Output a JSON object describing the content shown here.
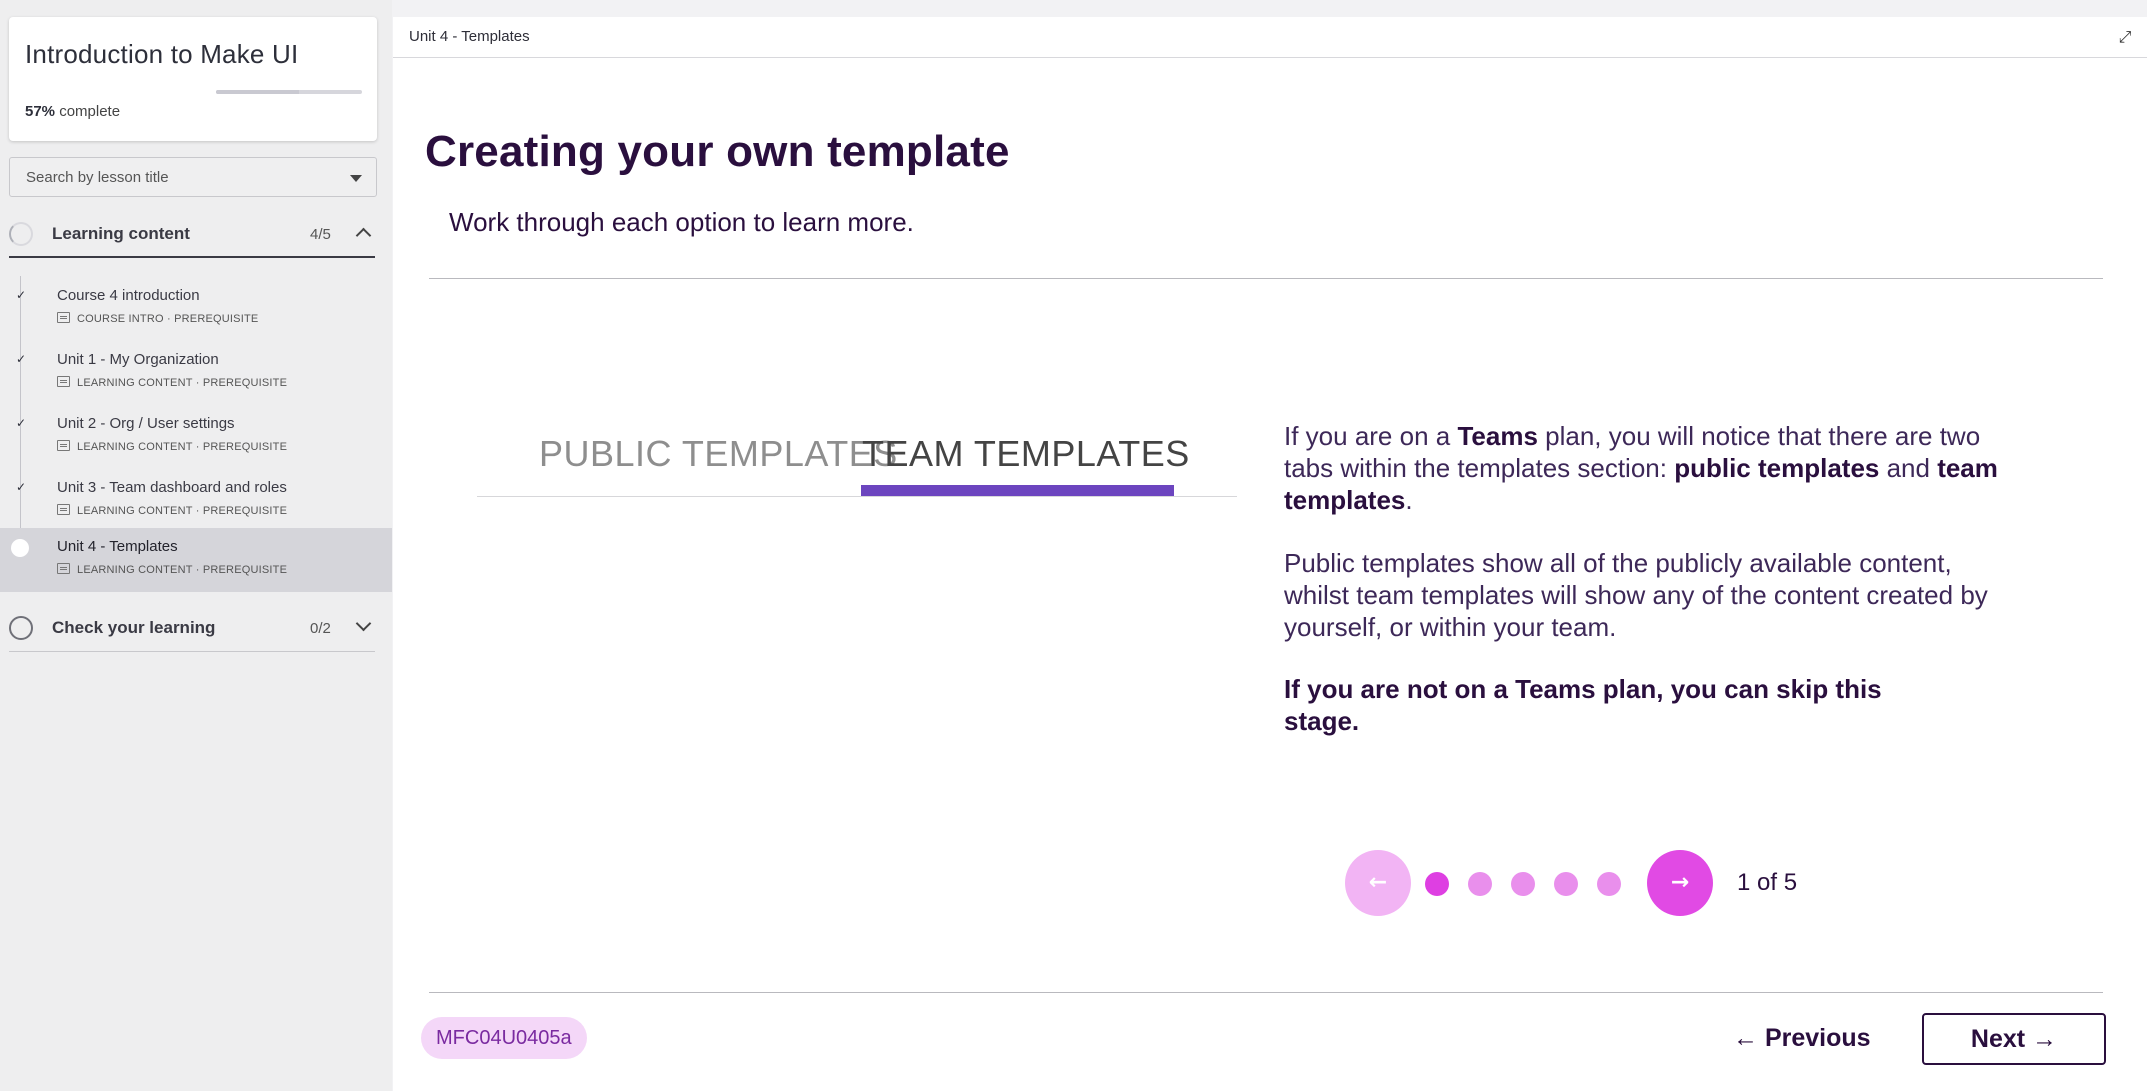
{
  "course": {
    "title": "Introduction to Make UI",
    "progress_percent": 57,
    "progress_value": "57%",
    "progress_suffix": "complete"
  },
  "search": {
    "placeholder": "Search by lesson title"
  },
  "sections": [
    {
      "title": "Learning content",
      "count": "4/5",
      "expanded": true,
      "lessons": [
        {
          "title": "Course 4 introduction",
          "meta": "COURSE INTRO · PREREQUISITE",
          "status": "done",
          "icon": "document-icon"
        },
        {
          "title": "Unit 1 - My Organization",
          "meta": "LEARNING CONTENT · PREREQUISITE",
          "status": "done",
          "icon": "slides-icon"
        },
        {
          "title": "Unit 2 - Org / User settings",
          "meta": "LEARNING CONTENT · PREREQUISITE",
          "status": "done",
          "icon": "slides-icon"
        },
        {
          "title": "Unit 3 - Team dashboard and roles",
          "meta": "LEARNING CONTENT · PREREQUISITE",
          "status": "done",
          "icon": "slides-icon"
        },
        {
          "title": "Unit 4 - Templates",
          "meta": "LEARNING CONTENT · PREREQUISITE",
          "status": "current",
          "icon": "slides-icon"
        }
      ]
    },
    {
      "title": "Check your learning",
      "count": "0/2",
      "expanded": false
    }
  ],
  "topbar": {
    "title": "Unit 4 - Templates",
    "expand_icon": "expand-icon"
  },
  "content": {
    "title": "Creating your own template",
    "subtitle": "Work through each option to learn more.",
    "tabs_image": {
      "left_tab": "PUBLIC TEMPLATES",
      "right_tab": "TEAM TEMPLATES",
      "active_tab": "TEAM TEMPLATES",
      "accent": "#6c45bf"
    },
    "paragraph1": {
      "t1": "If you are on a ",
      "b1": "Teams",
      "t2": " plan, you will notice that there are two tabs within the templates section: ",
      "b2": "public templates",
      "t3": " and ",
      "b3": "team templates",
      "t4": "."
    },
    "paragraph2": "Public templates show all of the publicly available content, whilst team templates will show any of the content created by yourself, or within your team.",
    "paragraph3": "If you are not on a Teams plan, you can skip this stage."
  },
  "carousel": {
    "current": 1,
    "total": 5,
    "label": "1 of 5",
    "prev_icon": "arrow-left-icon",
    "next_icon": "arrow-right-icon",
    "colors": {
      "active": "#de3fe2",
      "inactive": "#e98fec",
      "disabled": "#f2b4f4"
    }
  },
  "footer": {
    "code": "MFC04U0405a",
    "previous_label": "← Previous",
    "next_label": "Next →"
  },
  "colors": {
    "heading": "#2a0f3e",
    "accent": "#e14ae4",
    "tab_accent": "#6c45bf"
  }
}
